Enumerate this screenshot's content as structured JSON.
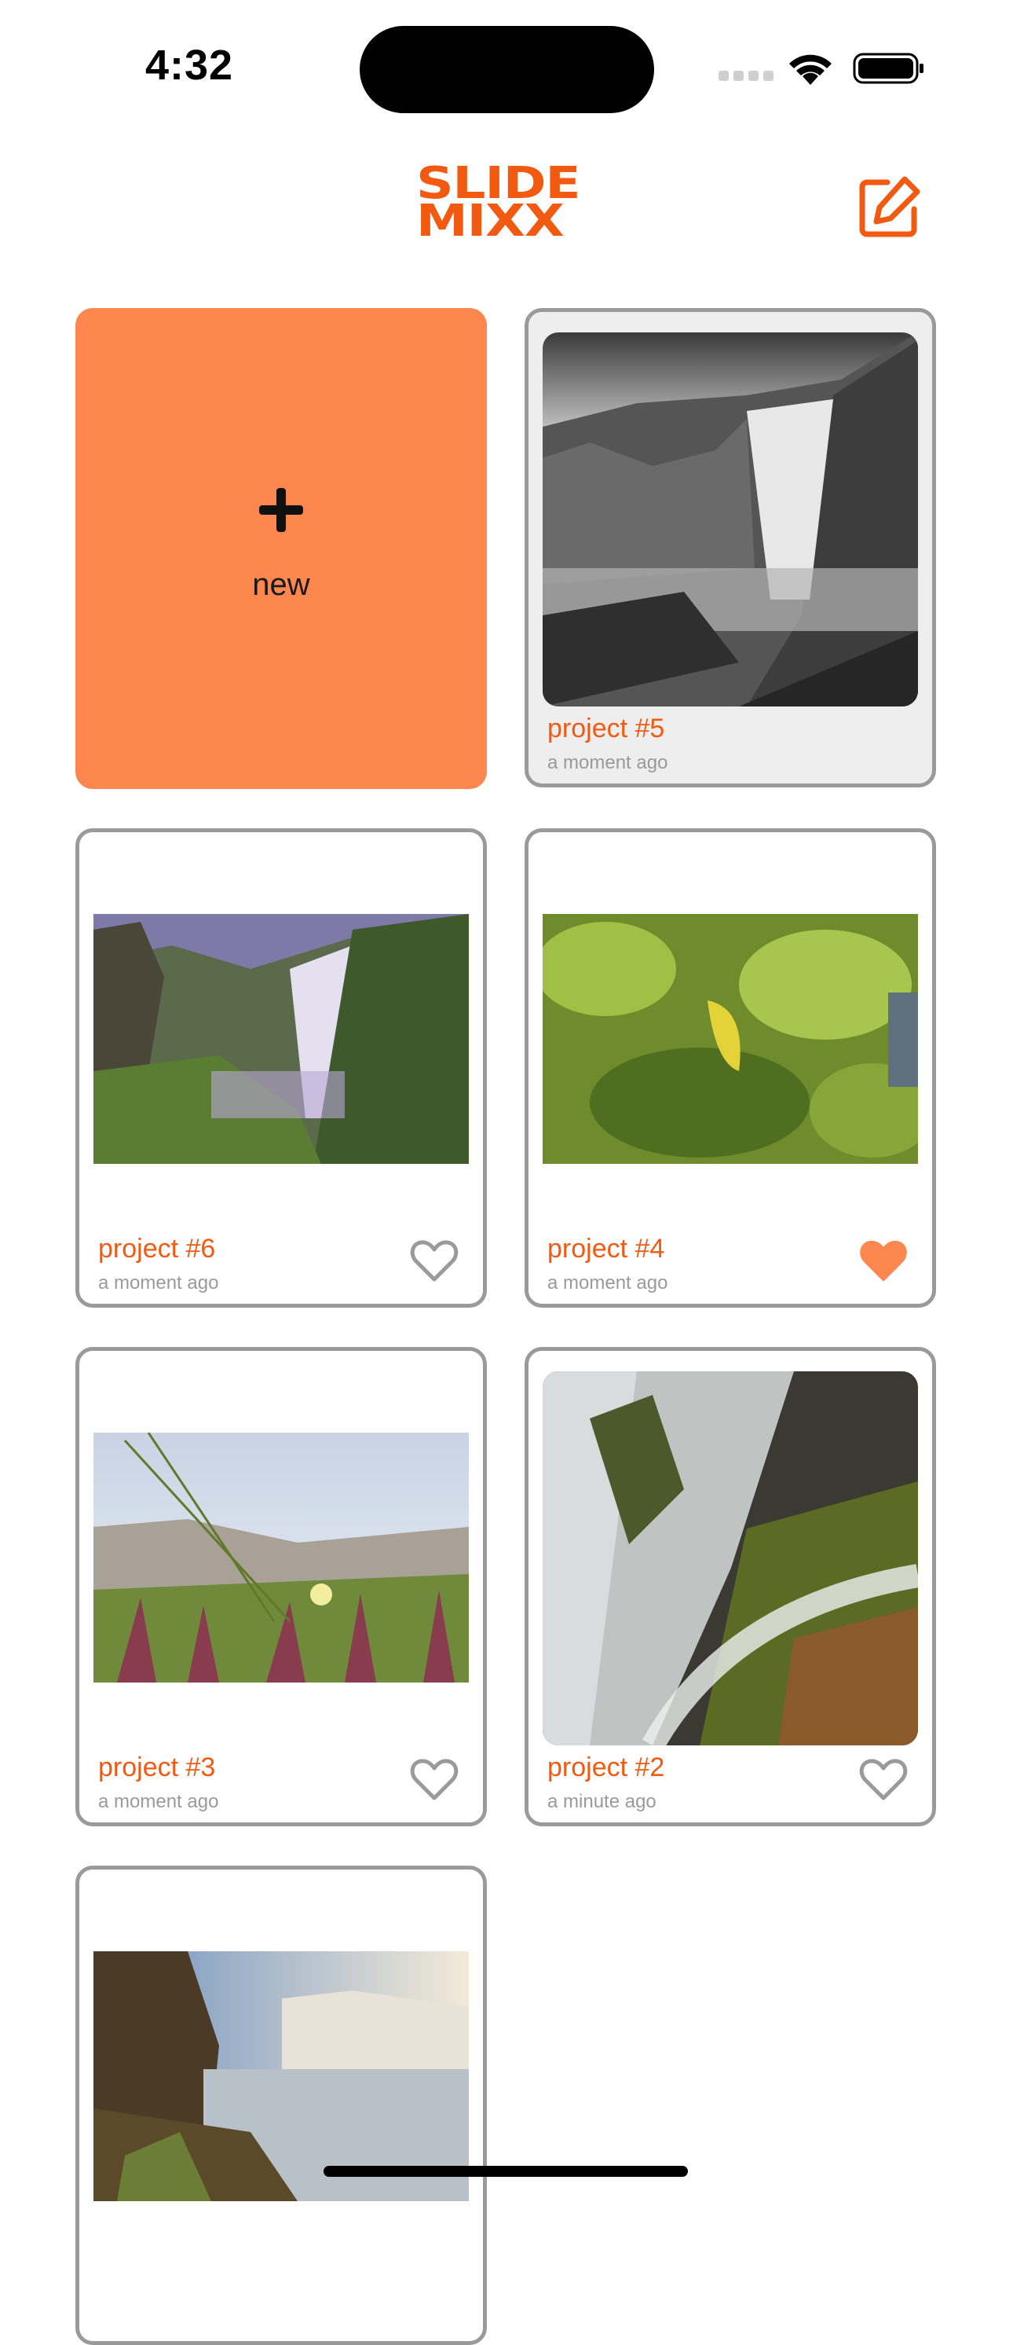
{
  "status": {
    "time": "4:32"
  },
  "app": {
    "logo_line1": "SLIDE",
    "logo_line2": "MIXX",
    "brand_color": "#f25a12",
    "accent_color": "#fe864f"
  },
  "new_card": {
    "label": "new",
    "icon": "plus-icon"
  },
  "projects": [
    {
      "title": "project #5",
      "time": "a moment ago",
      "favorite": null,
      "selected": true
    },
    {
      "title": "project #6",
      "time": "a moment ago",
      "favorite": false
    },
    {
      "title": "project #4",
      "time": "a moment ago",
      "favorite": true
    },
    {
      "title": "project #3",
      "time": "a moment ago",
      "favorite": false
    },
    {
      "title": "project #2",
      "time": "a minute ago",
      "favorite": false
    }
  ]
}
